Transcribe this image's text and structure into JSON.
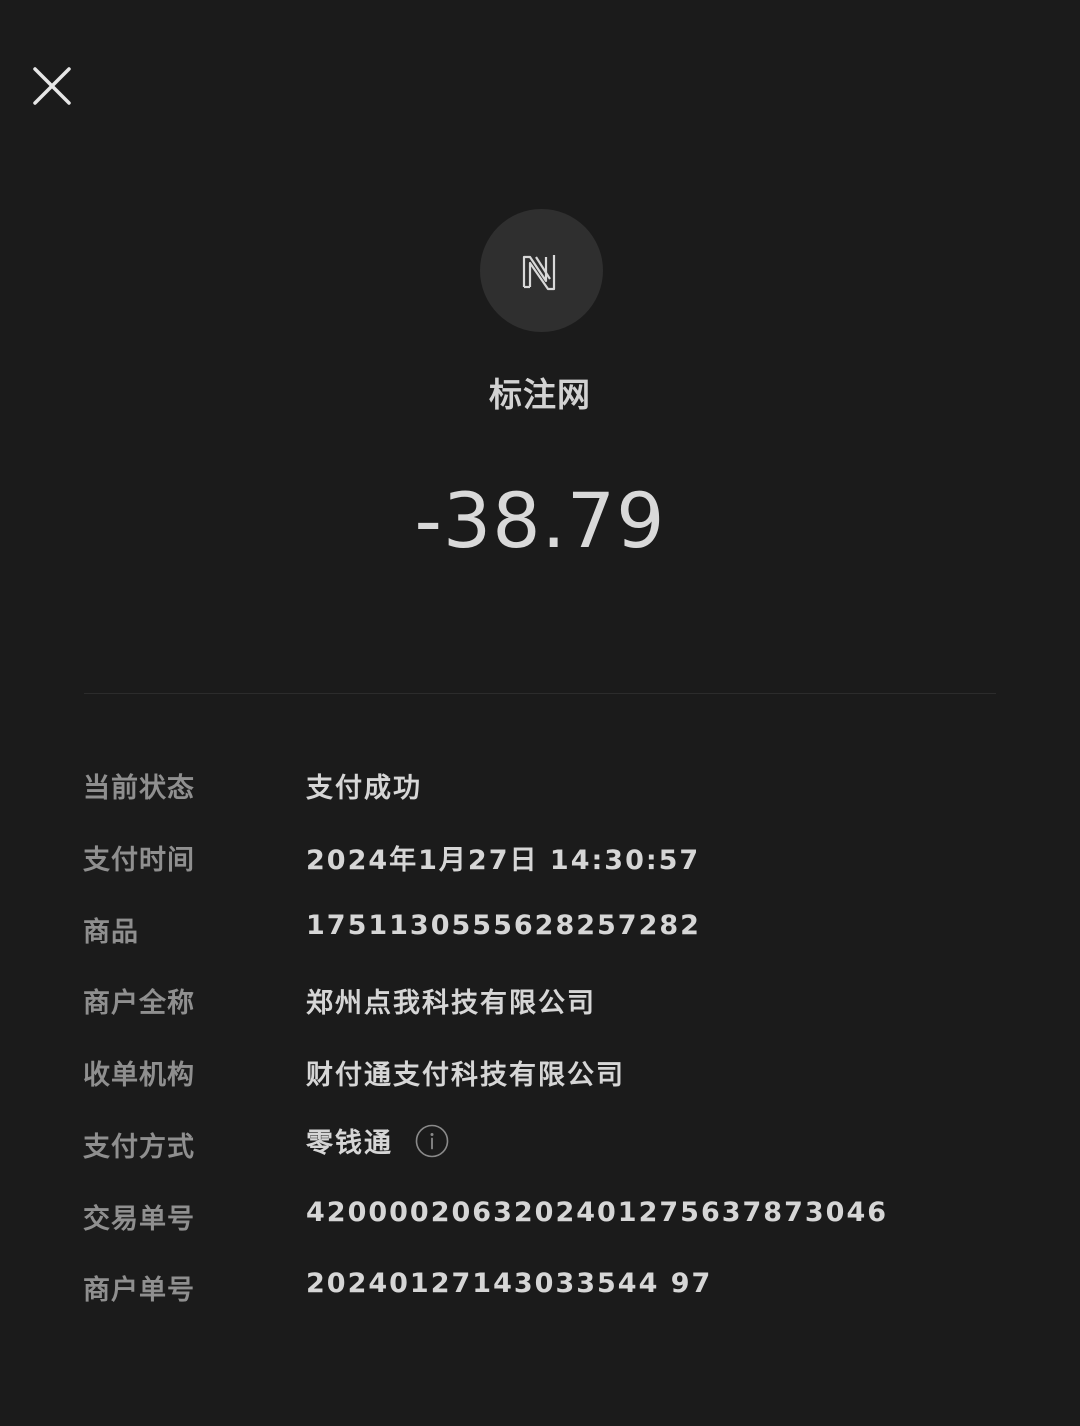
{
  "header": {
    "close_icon": "close-icon"
  },
  "merchant": {
    "logo_icon": "brand-logo-icon",
    "name": "标注网"
  },
  "amount": "-38.79",
  "details": [
    {
      "label": "当前状态",
      "value": "支付成功"
    },
    {
      "label": "支付时间",
      "value": "2024年1月27日 14:30:57"
    },
    {
      "label": "商品",
      "value": "1751130555628257282"
    },
    {
      "label": "商户全称",
      "value": "郑州点我科技有限公司"
    },
    {
      "label": "收单机构",
      "value": "财付通支付科技有限公司"
    },
    {
      "label": "支付方式",
      "value": "零钱通",
      "icon": "info-icon"
    },
    {
      "label": "交易单号",
      "value": "4200002063202401275637873046"
    },
    {
      "label": "商户单号",
      "value": "20240127143033544 97"
    }
  ],
  "colors": {
    "background": "#1b1b1b",
    "logo_circle": "#2f2f2f",
    "label_text": "#8f8f8f",
    "value_text": "#d6d6d6"
  }
}
